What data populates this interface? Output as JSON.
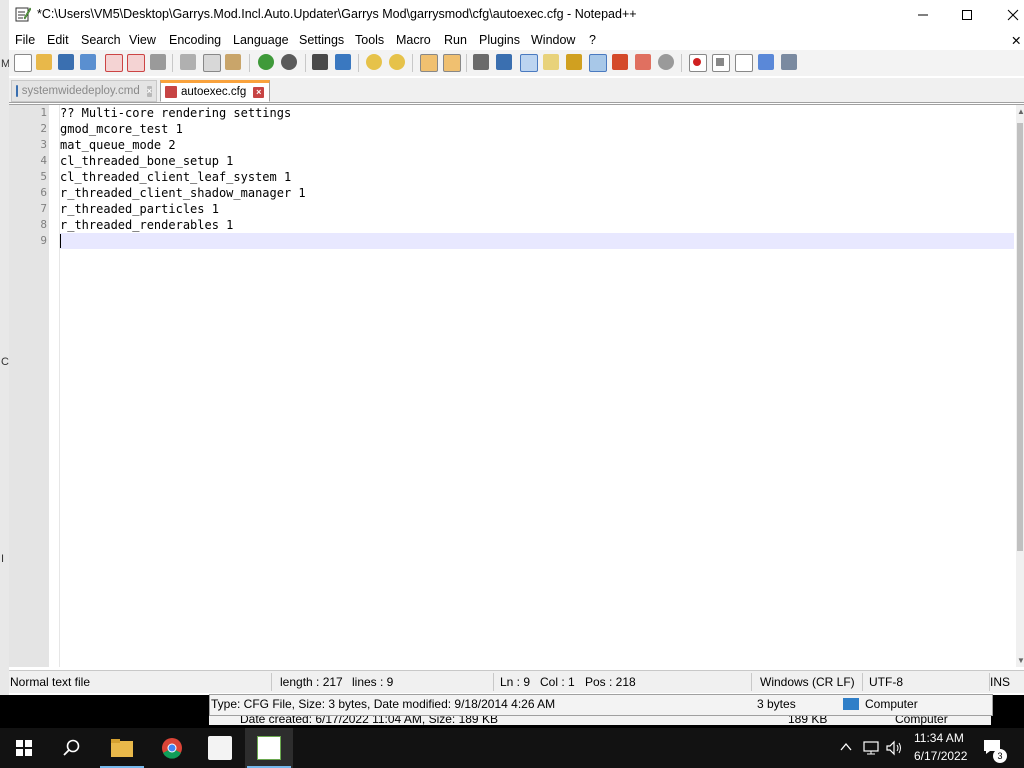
{
  "background": {
    "left_glyphs": [
      "M",
      "C",
      "I"
    ]
  },
  "window": {
    "title": "*C:\\Users\\VM5\\Desktop\\Garrys.Mod.Incl.Auto.Updater\\Garrys Mod\\garrysmod\\cfg\\autoexec.cfg - Notepad++",
    "minimize_icon": "minimize-icon",
    "maximize_icon": "maximize-icon",
    "close_icon": "close-icon",
    "menu_close_glyph": "✕"
  },
  "menu": {
    "items": [
      "File",
      "Edit",
      "Search",
      "View",
      "Encoding",
      "Language",
      "Settings",
      "Tools",
      "Macro",
      "Run",
      "Plugins",
      "Window",
      "?"
    ]
  },
  "toolbar": {
    "icons": [
      "new-file-icon",
      "open-file-icon",
      "save-icon",
      "save-all-icon",
      "close-icon",
      "close-all-icon",
      "print-icon",
      "cut-icon",
      "copy-icon",
      "paste-icon",
      "undo-icon",
      "redo-icon",
      "find-icon",
      "replace-icon",
      "zoom-in-icon",
      "zoom-out-icon",
      "sync-vertical-icon",
      "sync-horizontal-icon",
      "word-wrap-icon",
      "show-all-chars-icon",
      "indent-guide-icon",
      "user-language-icon",
      "doc-map-icon",
      "function-list-icon",
      "folder-workspace-icon",
      "doc-switcher-icon",
      "monitoring-icon",
      "record-macro-icon",
      "stop-macro-icon",
      "play-macro-icon",
      "run-macro-multiple-icon",
      "save-macro-icon"
    ]
  },
  "tabs": [
    {
      "label": "systemwidedeploy.cmd",
      "active": false
    },
    {
      "label": "autoexec.cfg",
      "active": true
    }
  ],
  "editor": {
    "lines": [
      {
        "num": "1",
        "text": "?? Multi-core rendering settings"
      },
      {
        "num": "2",
        "text": "gmod_mcore_test 1"
      },
      {
        "num": "3",
        "text": "mat_queue_mode 2"
      },
      {
        "num": "4",
        "text": "cl_threaded_bone_setup 1"
      },
      {
        "num": "5",
        "text": "cl_threaded_client_leaf_system 1"
      },
      {
        "num": "6",
        "text": "r_threaded_client_shadow_manager 1"
      },
      {
        "num": "7",
        "text": "r_threaded_particles 1"
      },
      {
        "num": "8",
        "text": "r_threaded_renderables 1"
      },
      {
        "num": "9",
        "text": ""
      }
    ]
  },
  "status": {
    "filetype": "Normal text file",
    "length": "length : 217",
    "lines": "lines : 9",
    "ln": "Ln : 9",
    "col": "Col : 1",
    "pos": "Pos : 218",
    "eol": "Windows (CR LF)",
    "encoding": "UTF-8",
    "mode": "INS"
  },
  "explorer_tooltip": {
    "line1": "Type: CFG File, Size: 3 bytes, Date modified: 9/18/2014 4:26 AM",
    "size1": "3 bytes",
    "computer1": "Computer",
    "line2": "Date created: 6/17/2022 11:04 AM, Size: 189 KB",
    "size2": "189 KB",
    "computer2": "Computer"
  },
  "taskbar": {
    "apps": [
      "start-icon",
      "search-icon",
      "file-explorer-icon",
      "chrome-icon",
      "java-icon",
      "notepadpp-icon"
    ],
    "time": "11:34 AM",
    "date": "6/17/2022",
    "notification_count": "3"
  },
  "colors": {
    "accent_tab": "#f9a23c",
    "current_line": "#e8e8ff",
    "taskbar": "#121212"
  }
}
